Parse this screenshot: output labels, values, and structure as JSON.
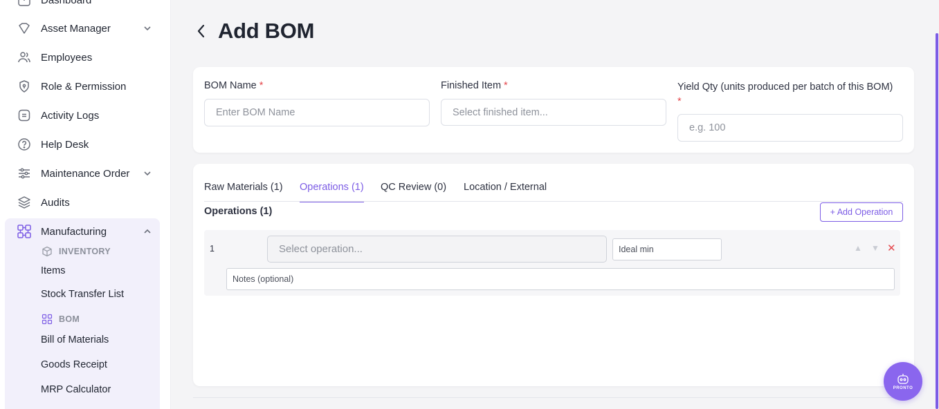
{
  "sidebar": {
    "items": [
      {
        "label": "Dashboard",
        "icon": "dashboard-icon"
      },
      {
        "label": "Asset Manager",
        "icon": "tag-icon",
        "expandable": true
      },
      {
        "label": "Employees",
        "icon": "users-icon"
      },
      {
        "label": "Role & Permission",
        "icon": "shield-icon"
      },
      {
        "label": "Activity Logs",
        "icon": "document-icon"
      },
      {
        "label": "Help Desk",
        "icon": "help-icon"
      },
      {
        "label": "Maintenance Order",
        "icon": "sliders-icon",
        "expandable": true
      },
      {
        "label": "Audits",
        "icon": "layers-icon"
      },
      {
        "label": "Manufacturing",
        "icon": "grid-icon",
        "expanded": true
      }
    ],
    "inventory": {
      "heading": "INVENTORY",
      "items": [
        "Items",
        "Stock Transfer List"
      ]
    },
    "bom": {
      "heading": "BOM",
      "items": [
        "Bill of Materials",
        "Goods Receipt",
        "MRP Calculator"
      ]
    }
  },
  "page": {
    "title": "Add BOM"
  },
  "form": {
    "bom_name": {
      "label": "BOM Name",
      "placeholder": "Enter BOM Name",
      "required": "*"
    },
    "finished_item": {
      "label": "Finished Item",
      "placeholder": "Select finished item...",
      "required": "*"
    },
    "yield_qty": {
      "label": "Yield Qty (units produced per batch of this BOM)",
      "placeholder": "e.g. 100",
      "required": "*"
    }
  },
  "tabs": [
    {
      "label": "Raw Materials (1)",
      "active": false
    },
    {
      "label": "Operations (1)",
      "active": true
    },
    {
      "label": "QC Review (0)",
      "active": false
    },
    {
      "label": "Location / External",
      "active": false
    }
  ],
  "operations": {
    "title": "Operations (1)",
    "add_label": "+ Add Operation",
    "rows": [
      {
        "number": "1",
        "select_placeholder": "Select operation...",
        "min_placeholder": "Ideal min",
        "notes_placeholder": "Notes (optional)",
        "up": "▲",
        "down": "▼",
        "remove": "✕"
      }
    ]
  },
  "assistant": {
    "label": "PRONTO"
  },
  "colors": {
    "accent": "#7c5ce5",
    "required": "#e5484d",
    "active_section_bg": "#f2f0fb"
  }
}
